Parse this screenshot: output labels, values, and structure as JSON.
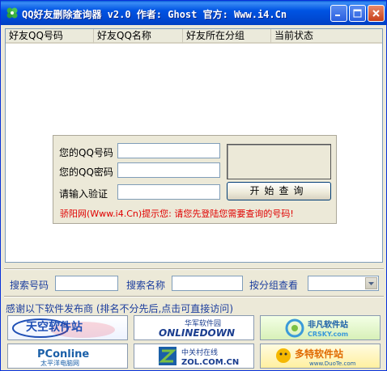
{
  "window": {
    "title": "QQ好友删除查询器 v2.0 作者: Ghost 官方: Www.i4.Cn"
  },
  "listview": {
    "columns": [
      "好友QQ号码",
      "好友QQ名称",
      "好友所在分组",
      "当前状态"
    ]
  },
  "query": {
    "qq_label": "您的QQ号码",
    "pwd_label": "您的QQ密码",
    "captcha_label": "请输入验证",
    "query_button": "开始查询",
    "hint": "骄阳网(Www.i4.Cn)提示您: 请您先登陆您需要查询的号码!"
  },
  "search": {
    "number_label": "搜索号码",
    "name_label": "搜索名称",
    "group_label": "按分组查看"
  },
  "sponsors": {
    "intro": "感谢以下软件发布商 (排名不分先后,点击可直接访问)",
    "items": [
      {
        "main": "天空软件站",
        "sub": ""
      },
      {
        "main": "华军软件园",
        "sub": "ONLINEDOWN"
      },
      {
        "main": "非凡软件站",
        "sub": "CRSKY.com"
      },
      {
        "main": "PConline",
        "sub": "太平洋电脑网"
      },
      {
        "main": "中关村在线",
        "sub": "ZOL.COM.CN"
      },
      {
        "main": "多特软件站",
        "sub": "www.DuoTe.com"
      }
    ]
  },
  "colors": {
    "titlebar": "#0054e3",
    "label_blue": "#1b3d9e",
    "hint_red": "#e00000"
  }
}
